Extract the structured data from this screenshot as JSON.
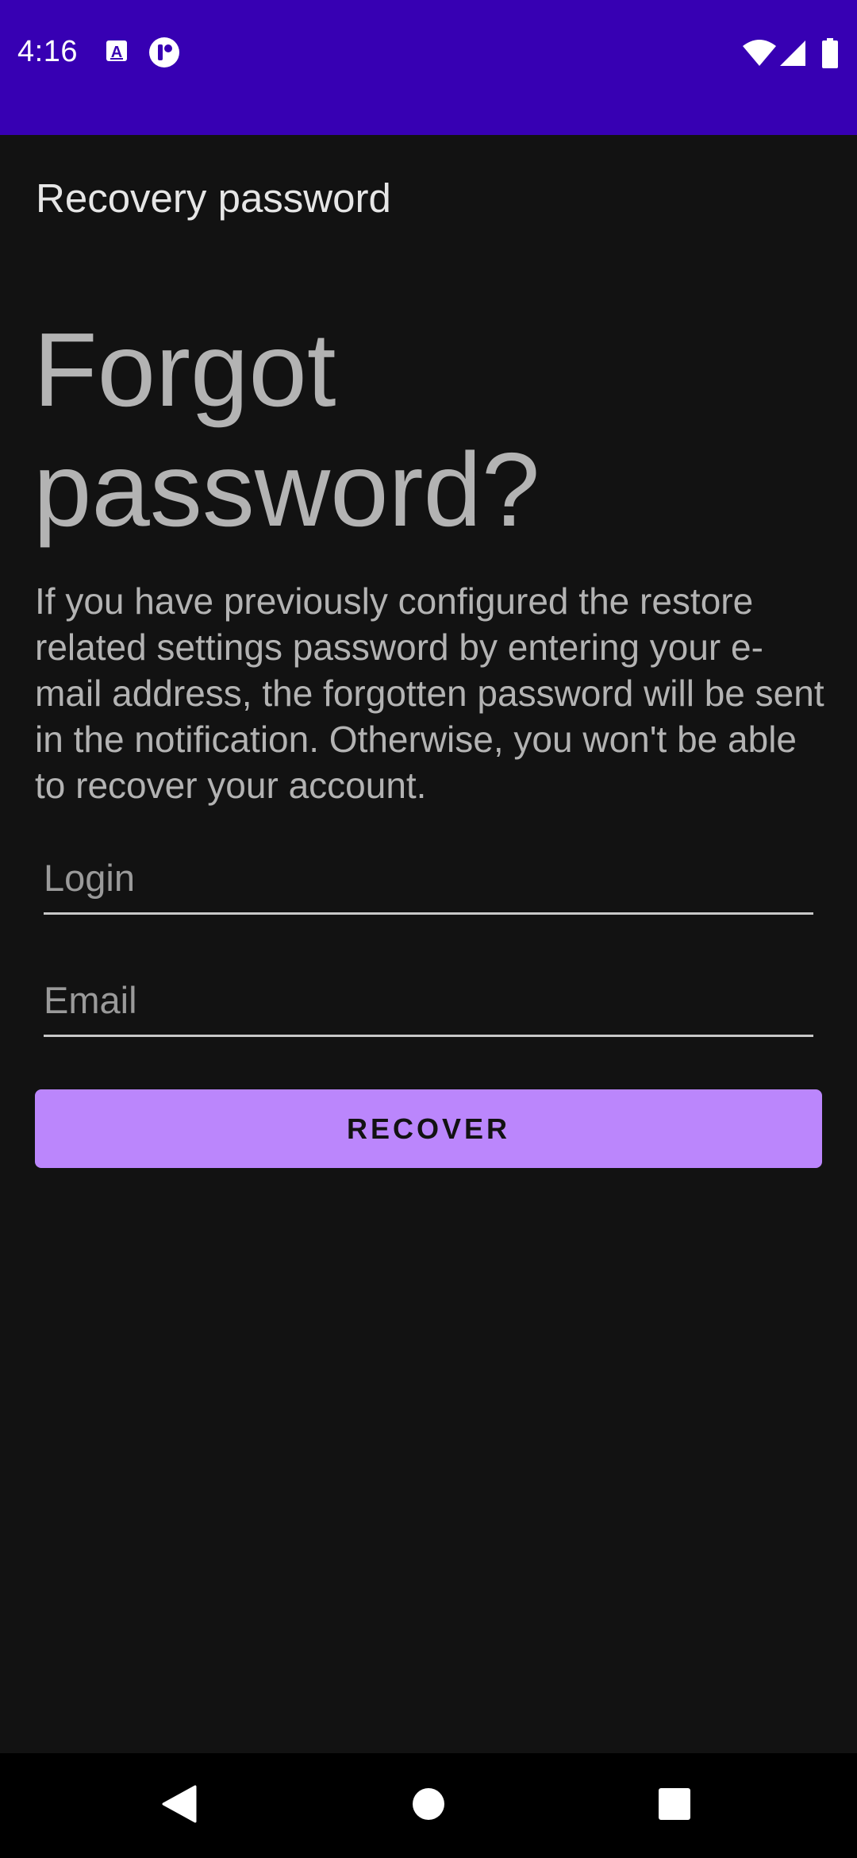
{
  "status_bar": {
    "time": "4:16",
    "left_icons": [
      "keyboard-a-icon",
      "app-notification-icon"
    ],
    "right_icons": [
      "wifi-icon",
      "cell-signal-icon",
      "battery-icon"
    ],
    "color": "#3700b3"
  },
  "app_bar": {
    "title": "Recovery password"
  },
  "main": {
    "headline": "Forgot password?",
    "description": "If you have previously configured the restore related settings password by entering your e-mail address, the forgotten password will be sent in the notification. Otherwise, you won't be able to recover your account.",
    "login_field": {
      "value": "",
      "placeholder": "Login"
    },
    "email_field": {
      "value": "",
      "placeholder": "Email"
    },
    "recover_button": {
      "label": "RECOVER",
      "color": "#bb86fc"
    }
  },
  "nav_bar": {
    "buttons": [
      "back-icon",
      "home-icon",
      "recents-icon"
    ]
  }
}
